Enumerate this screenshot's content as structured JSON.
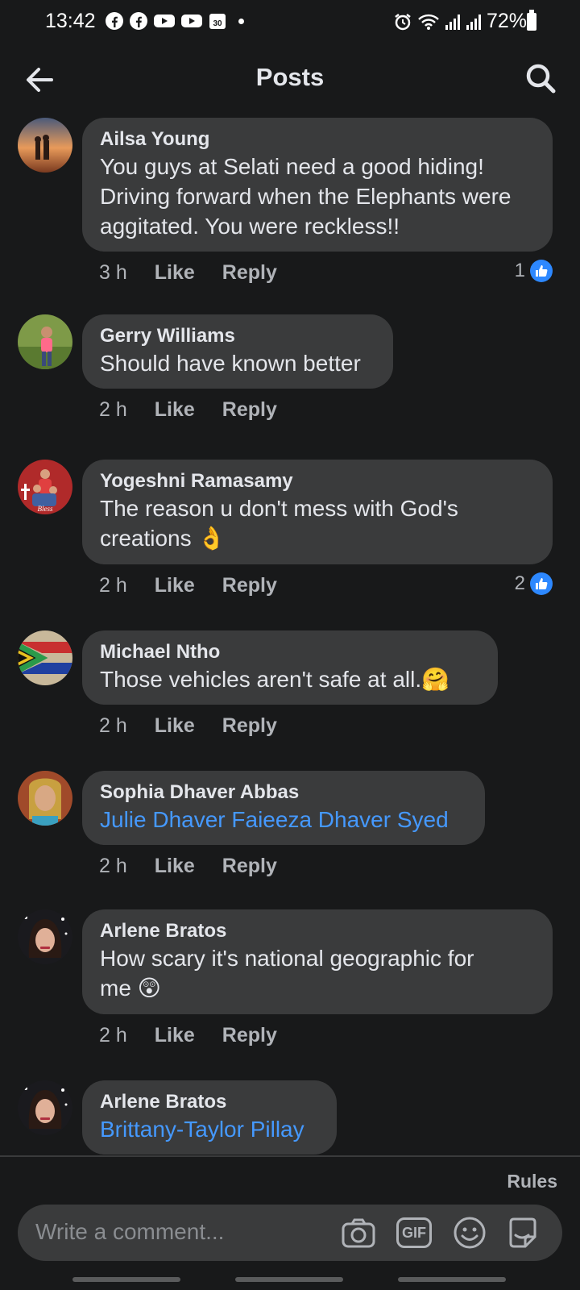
{
  "status_bar": {
    "time": "13:42",
    "battery": "72%",
    "left_icons": [
      "facebook-icon",
      "facebook-icon",
      "youtube-icon",
      "youtube-icon",
      "calendar-icon"
    ],
    "calendar_day": "30",
    "right_icons": [
      "alarm-icon",
      "wifi-icon",
      "signal-icon",
      "signal-icon",
      "battery-icon"
    ]
  },
  "header": {
    "title": "Posts"
  },
  "comments": [
    {
      "author": "Ailsa Young",
      "lines": [
        "You guys at Selati need a good hiding!",
        "Driving forward when the Elephants were",
        "aggitated. You were reckless!!"
      ],
      "time": "3 h",
      "like": "Like",
      "reply": "Reply",
      "reactions": "1"
    },
    {
      "author": "Gerry Williams",
      "lines": [
        "Should have known better"
      ],
      "time": "2 h",
      "like": "Like",
      "reply": "Reply"
    },
    {
      "author": "Yogeshni Ramasamy",
      "lines": [
        "The reason u don't mess with God's",
        "creations 👌"
      ],
      "time": "2 h",
      "like": "Like",
      "reply": "Reply",
      "reactions": "2"
    },
    {
      "author": "Michael Ntho",
      "lines": [
        "Those vehicles aren't safe at all.🤗"
      ],
      "time": "2 h",
      "like": "Like",
      "reply": "Reply"
    },
    {
      "author": "Sophia Dhaver Abbas",
      "lines": [
        "Julie Dhaver Faieeza Dhaver Syed"
      ],
      "time": "2 h",
      "like": "Like",
      "reply": "Reply"
    },
    {
      "author": "Arlene Bratos",
      "lines": [
        "How scary it's national geographic for",
        "me 😲"
      ],
      "time": "2 h",
      "like": "Like",
      "reply": "Reply"
    },
    {
      "author": "Arlene Bratos",
      "lines": [
        "Brittany-Taylor Pillay"
      ]
    }
  ],
  "composer": {
    "rules": "Rules",
    "placeholder": "Write a comment...",
    "gif_label": "GIF",
    "icons": [
      "camera-icon",
      "gif-icon",
      "emoji-icon",
      "sticker-icon"
    ]
  },
  "colors": {
    "background": "#18191a",
    "bubble": "#3a3b3c",
    "link": "#4599ff",
    "like_badge": "#2d88ff"
  }
}
